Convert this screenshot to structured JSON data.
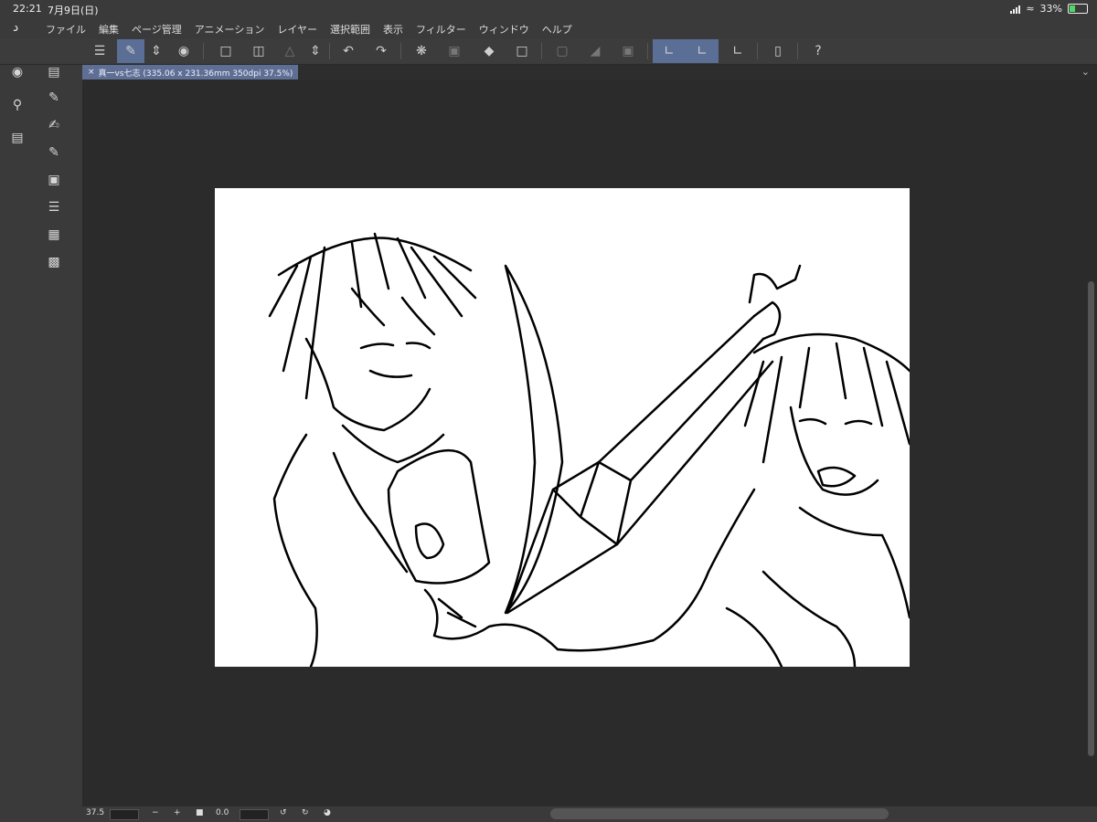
{
  "status": {
    "time": "22:21",
    "date": "7月9日(日)",
    "battery": "33%"
  },
  "menu": {
    "items": [
      "ファイル",
      "編集",
      "ページ管理",
      "アニメーション",
      "レイヤー",
      "選択範囲",
      "表示",
      "フィルター",
      "ウィンドウ",
      "ヘルプ"
    ]
  },
  "toolbar": {
    "icons": {
      "menu": "hamburger-icon",
      "canvas": "canvas-icon",
      "updown": "chevron-updown-icon",
      "gallery": "gallery-icon",
      "new": "new-canvas-icon",
      "open": "open-folder-icon",
      "export": "export-icon",
      "undo": "undo-icon",
      "redo": "redo-icon",
      "loading": "spinner-icon",
      "transform": "transform-icon",
      "fill": "fill-icon",
      "crop": "crop-icon",
      "snap": "snap-icon",
      "ruler": "ruler-icon",
      "phone": "device-icon",
      "help": "help-icon"
    },
    "accent": "#5a6e96"
  },
  "document": {
    "tab_label": "真一vs七志 (335.06 x 231.36mm 350dpi 37.5%)"
  },
  "bottom": {
    "zoom": "37.5",
    "minus": "−",
    "plus": "+",
    "rotation": "0.0"
  }
}
